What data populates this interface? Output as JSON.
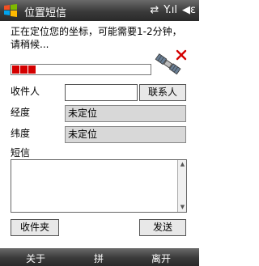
{
  "window": {
    "title": "位置短信"
  },
  "status_icons": {
    "data": "⇄",
    "signal": "Y.ıl",
    "volume": "◀ε"
  },
  "message": "正在定位您的坐标，可能需要1-2分钟，请稍候...",
  "progress": {
    "filled_segments": 3
  },
  "form": {
    "recipient_label": "收件人",
    "recipient_value": "",
    "contacts_button": "联系人",
    "longitude_label": "经度",
    "longitude_value": "未定位",
    "latitude_label": "纬度",
    "latitude_value": "未定位",
    "sms_label": "短信",
    "sms_value": ""
  },
  "buttons": {
    "inbox": "收件夹",
    "send": "发送"
  },
  "softkeys": {
    "left": "关于",
    "center": "拼",
    "right": "离开"
  },
  "colors": {
    "progress": "#d40000",
    "bar": "#3a3a3a",
    "field_disabled": "#d8d8d8"
  },
  "icons": [
    "windows-start-icon",
    "satellite-icon",
    "scroll-up-icon",
    "scroll-down-icon"
  ]
}
